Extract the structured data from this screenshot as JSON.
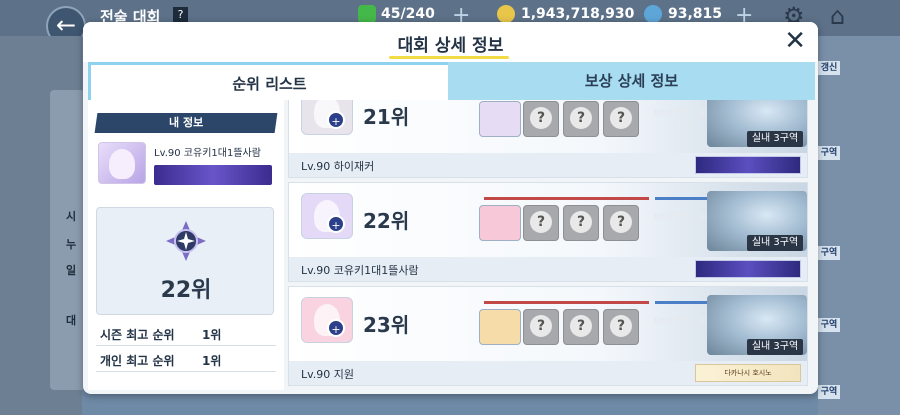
{
  "background": {
    "title": "전술 대회",
    "help": "?",
    "resources": [
      {
        "name": "ap",
        "icon": "lightning-icon",
        "value": "45/240",
        "color": "#45b84a"
      },
      {
        "name": "credit",
        "icon": "coin-icon",
        "value": "1,943,718,930",
        "color": "#e8c64a"
      },
      {
        "name": "pyroxene",
        "icon": "gem-icon",
        "value": "93,815",
        "color": "#5ea6d8"
      }
    ],
    "left_labels": [
      "시",
      "누",
      "일",
      "대"
    ],
    "right_tags": [
      "갱신",
      "구역",
      "구역",
      "구역",
      "구역"
    ]
  },
  "modal": {
    "title": "대회 상세 정보",
    "close": "✕",
    "tabs": [
      {
        "label": "순위 리스트",
        "active": true
      },
      {
        "label": "보상 상세 정보",
        "active": false
      }
    ]
  },
  "my_info": {
    "header": "내 정보",
    "name": "Lv.90 코유키1대1뜰사람",
    "rank": "22위",
    "stats": [
      {
        "label": "시즌 최고 순위",
        "value": "1위"
      },
      {
        "label": "개인 최고 순위",
        "value": "1위"
      }
    ]
  },
  "rank_list": [
    {
      "rank": "21위",
      "player": "Lv.90 하이재커",
      "portrait_color": "#e8e4ec",
      "main_color": "#e6dcf3",
      "empties": [
        "EMPTY",
        "EMPTY"
      ],
      "stage": "실내 3구역",
      "banner": "dark"
    },
    {
      "rank": "22위",
      "player": "Lv.90 코유키1대1뜰사람",
      "portrait_color": "#e4d9f7",
      "main_color": "#f6c8d8",
      "empties": [
        "EMPTY",
        "EMPTY"
      ],
      "stage": "실내 3구역",
      "banner": "dark"
    },
    {
      "rank": "23위",
      "player": "Lv.90 지원",
      "portrait_color": "#f9d3df",
      "main_color": "#f5dca8",
      "empties": [
        "EMPTY",
        "EMPTY"
      ],
      "stage": "실내 3구역",
      "banner": "light",
      "banner_text": "다카나시 호시노"
    }
  ],
  "colors": {
    "accent_yellow": "#f1dc45",
    "tab_inactive": "#a7dcf1",
    "navy": "#2b4669"
  }
}
